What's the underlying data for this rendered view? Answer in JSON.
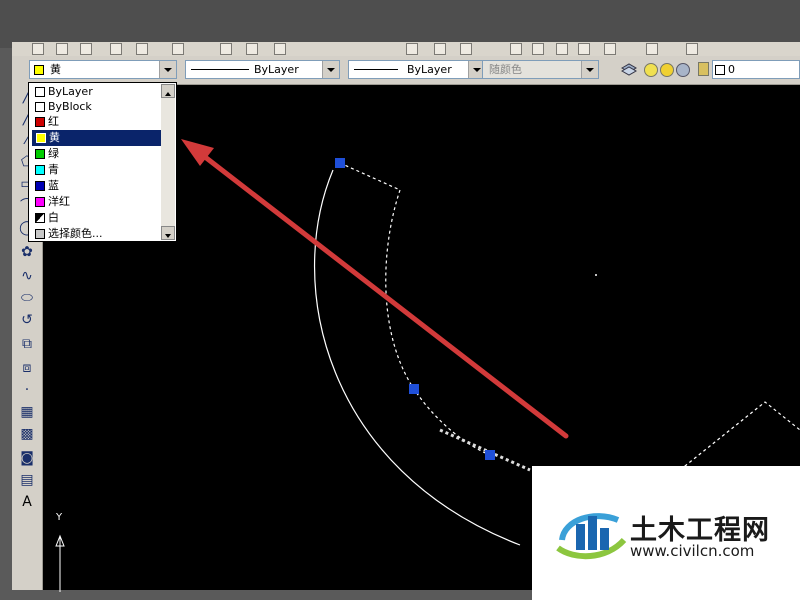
{
  "toolbar": {
    "color_combo_value": "黄",
    "linetype_combo_value": "ByLayer",
    "lineweight_combo_value": "ByLayer",
    "plotstyle_combo_value": "随颜色",
    "layer_value": "0"
  },
  "color_dropdown": {
    "items": [
      {
        "label": "ByLayer",
        "color": "#ffffff"
      },
      {
        "label": "ByBlock",
        "color": "#ffffff"
      },
      {
        "label": "红",
        "color": "#cc0000"
      },
      {
        "label": "黄",
        "color": "#ffff00",
        "selected": true
      },
      {
        "label": "绿",
        "color": "#00cc00"
      },
      {
        "label": "青",
        "color": "#00ffff"
      },
      {
        "label": "蓝",
        "color": "#0000b4"
      },
      {
        "label": "洋红",
        "color": "#ff00ff"
      },
      {
        "label": "白",
        "color": "#ffffff"
      },
      {
        "label": "选择颜色..."
      }
    ]
  },
  "side_tools": [
    "line-icon",
    "ray-icon",
    "polygon-icon",
    "rectangle-icon",
    "arc-icon",
    "circle-icon",
    "revcloud-icon",
    "spline-icon",
    "ellipse-icon",
    "ellipse-arc-icon",
    "insert-block-icon",
    "make-block-icon",
    "point-icon",
    "hatch-icon",
    "gradient-icon",
    "region-icon",
    "table-icon",
    "text-icon"
  ],
  "side_text_glyph": "A",
  "ucs": {
    "y_label": "Y"
  },
  "watermark": {
    "title": "土木工程网",
    "url": "www.civilcn.com"
  },
  "colors": {
    "grip": "#1f4fd8",
    "arrow": "#d23a3a",
    "selection_highlight": "#0a246a"
  }
}
